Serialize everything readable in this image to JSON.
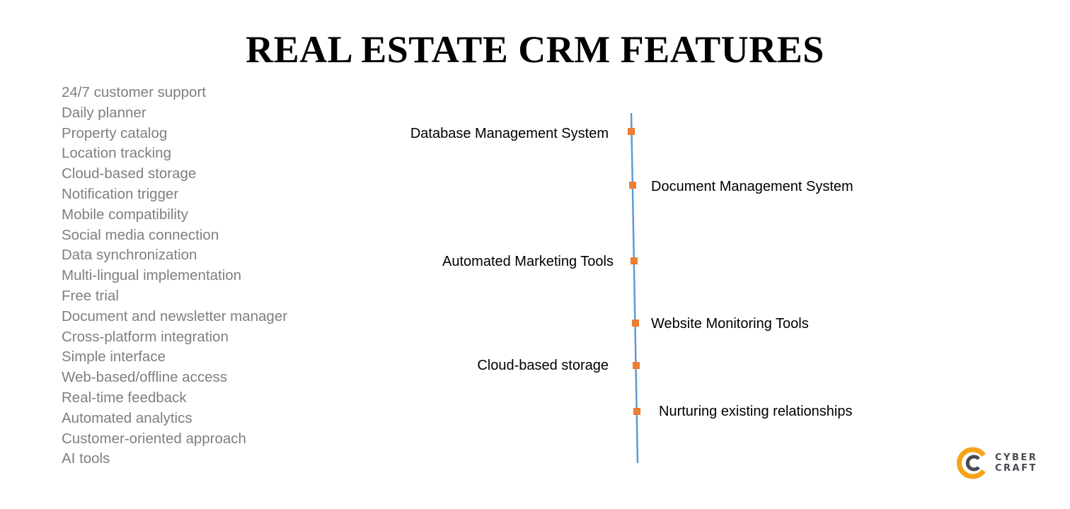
{
  "title": "REAL ESTATE CRM FEATURES",
  "feature_list": [
    "24/7 customer support",
    "Daily planner",
    "Property catalog",
    "Location tracking",
    "Cloud-based storage",
    "Notification trigger",
    "Mobile compatibility",
    "Social media connection",
    "Data synchronization",
    "Multi-lingual implementation",
    "Free trial",
    "Document and newsletter manager",
    "Cross-platform integration",
    "Simple interface",
    "Web-based/offline access",
    "Real-time feedback",
    "Automated analytics",
    "Customer-oriented approach",
    "AI tools"
  ],
  "timeline": {
    "line_color": "#5b9bd5",
    "marker_color": "#ed7d31",
    "items": [
      {
        "label": "Database Management System",
        "side": "left"
      },
      {
        "label": "Document Management System",
        "side": "right"
      },
      {
        "label": "Automated Marketing Tools",
        "side": "left"
      },
      {
        "label": "Website Monitoring Tools",
        "side": "right"
      },
      {
        "label": "Cloud-based storage",
        "side": "left"
      },
      {
        "label": "Nurturing existing relationships",
        "side": "right"
      }
    ]
  },
  "logo": {
    "line1": "CYBER",
    "line2": "CRAFT",
    "ring_color": "#f7a21b",
    "text_color": "#4a4a55"
  }
}
